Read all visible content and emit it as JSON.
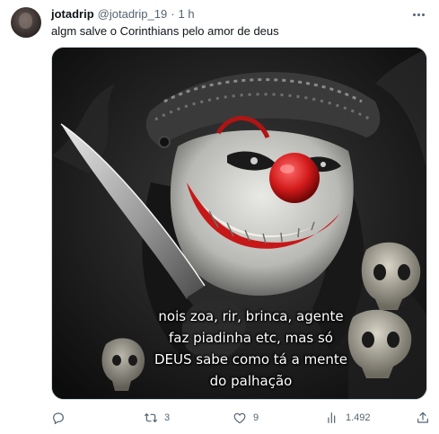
{
  "tweet": {
    "display_name": "jotadrip",
    "handle": "@jotadrip_19",
    "separator": "·",
    "time": "1 h",
    "text": "algm salve o Corinthians pelo amor de deus",
    "media": {
      "caption_lines": [
        "nois zoa, rir, brinca, agente",
        "faz piadinha etc, mas só",
        "DEUS sabe como tá a mente",
        "do palhação"
      ]
    },
    "actions": {
      "reply_count": "",
      "retweet_count": "3",
      "like_count": "9",
      "views_count": "1.492"
    }
  },
  "icons": {
    "more": "more-horizontal-icon",
    "reply": "reply-bubble-icon",
    "retweet": "retweet-icon",
    "like": "heart-icon",
    "views": "views-bar-chart-icon",
    "share": "share-upload-icon"
  }
}
